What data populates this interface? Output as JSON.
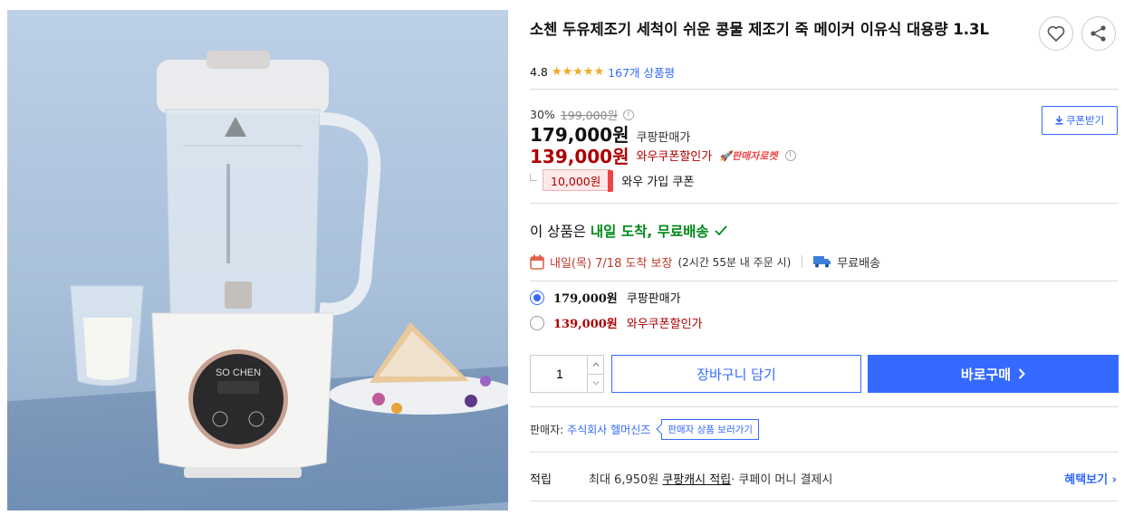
{
  "product": {
    "title": "소첸 두유제조기 세척이 쉬운 콩물 제조기 죽 메이커 이유식 대용량 1.3L",
    "rating_value": "4.8",
    "review_count": "167개 상품평",
    "image_brand_text": "SO CHEN"
  },
  "pricing": {
    "discount_rate": "30%",
    "original_price": "199,000원",
    "sale_price": "179,000원",
    "sale_label": "쿠팡판매가",
    "wow_price": "139,000원",
    "wow_label": "와우쿠폰할인가",
    "rocket_label": "판매자로켓",
    "coupon_button": "쿠폰받기",
    "coupon_amount": "10,000원",
    "coupon_label": "와우 가입 쿠폰"
  },
  "delivery": {
    "headline_prefix": "이 상품은 ",
    "headline_highlight": "내일 도착, 무료배송",
    "date_text": "내일(목) 7/18 도착 보장",
    "date_sub": "(2시간 55분 내 주문 시)",
    "free_shipping": "무료배송"
  },
  "options": [
    {
      "price": "179,000원",
      "label": "쿠팡판매가",
      "selected": true
    },
    {
      "price": "139,000원",
      "label": "와우쿠폰할인가",
      "selected": false
    }
  ],
  "purchase": {
    "quantity": "1",
    "cart_button": "장바구니 담기",
    "buy_button": "바로구매"
  },
  "seller": {
    "label": "판매자:",
    "name": "주식회사 헬머신즈",
    "more_button": "판매자 상품 보러가기"
  },
  "points": {
    "label": "적립",
    "text_prefix": "최대 6,950원 ",
    "text_link": "쿠팡캐시 적립",
    "text_suffix": " · 쿠페이 머니 결제시",
    "benefit_link": "혜택보기"
  },
  "colors": {
    "accent": "#346aff",
    "price_red": "#ae0000",
    "delivery_green": "#00891a",
    "star": "#f2a91d"
  },
  "icons": [
    "heart-icon",
    "share-icon",
    "info-icon",
    "download-icon",
    "rocket-icon",
    "calendar-icon",
    "truck-icon",
    "check-icon",
    "chevron-right-icon",
    "chevron-up-icon",
    "chevron-down-icon"
  ]
}
